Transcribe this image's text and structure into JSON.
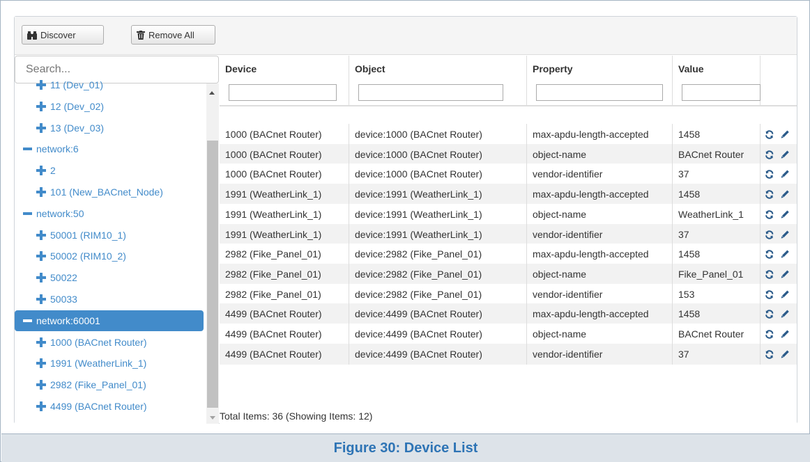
{
  "toolbar": {
    "discover_label": "Discover",
    "remove_all_label": "Remove All"
  },
  "sidebar": {
    "search_placeholder": "Search...",
    "tree": [
      {
        "label": "11 (Dev_01)",
        "kind": "device",
        "level": 1
      },
      {
        "label": "12 (Dev_02)",
        "kind": "device",
        "level": 1
      },
      {
        "label": "13 (Dev_03)",
        "kind": "device",
        "level": 1
      },
      {
        "label": "network:6",
        "kind": "network",
        "level": 0
      },
      {
        "label": "2",
        "kind": "device",
        "level": 1
      },
      {
        "label": "101 (New_BACnet_Node)",
        "kind": "device",
        "level": 1
      },
      {
        "label": "network:50",
        "kind": "network",
        "level": 0
      },
      {
        "label": "50001 (RIM10_1)",
        "kind": "device",
        "level": 1
      },
      {
        "label": "50002 (RIM10_2)",
        "kind": "device",
        "level": 1
      },
      {
        "label": "50022",
        "kind": "device",
        "level": 1
      },
      {
        "label": "50033",
        "kind": "device",
        "level": 1
      },
      {
        "label": "network:60001",
        "kind": "network",
        "level": 0,
        "selected": true
      },
      {
        "label": "1000 (BACnet Router)",
        "kind": "device",
        "level": 1
      },
      {
        "label": "1991 (WeatherLink_1)",
        "kind": "device",
        "level": 1
      },
      {
        "label": "2982 (Fike_Panel_01)",
        "kind": "device",
        "level": 1
      },
      {
        "label": "4499 (BACnet Router)",
        "kind": "device",
        "level": 1
      }
    ]
  },
  "grid": {
    "columns": [
      "Device",
      "Object",
      "Property",
      "Value"
    ],
    "rows": [
      [
        "1000 (BACnet Router)",
        "device:1000 (BACnet Router)",
        "max-apdu-length-accepted",
        "1458"
      ],
      [
        "1000 (BACnet Router)",
        "device:1000 (BACnet Router)",
        "object-name",
        "BACnet Router"
      ],
      [
        "1000 (BACnet Router)",
        "device:1000 (BACnet Router)",
        "vendor-identifier",
        "37"
      ],
      [
        "1991 (WeatherLink_1)",
        "device:1991 (WeatherLink_1)",
        "max-apdu-length-accepted",
        "1458"
      ],
      [
        "1991 (WeatherLink_1)",
        "device:1991 (WeatherLink_1)",
        "object-name",
        "WeatherLink_1"
      ],
      [
        "1991 (WeatherLink_1)",
        "device:1991 (WeatherLink_1)",
        "vendor-identifier",
        "37"
      ],
      [
        "2982 (Fike_Panel_01)",
        "device:2982 (Fike_Panel_01)",
        "max-apdu-length-accepted",
        "1458"
      ],
      [
        "2982 (Fike_Panel_01)",
        "device:2982 (Fike_Panel_01)",
        "object-name",
        "Fike_Panel_01"
      ],
      [
        "2982 (Fike_Panel_01)",
        "device:2982 (Fike_Panel_01)",
        "vendor-identifier",
        "153"
      ],
      [
        "4499 (BACnet Router)",
        "device:4499 (BACnet Router)",
        "max-apdu-length-accepted",
        "1458"
      ],
      [
        "4499 (BACnet Router)",
        "device:4499 (BACnet Router)",
        "object-name",
        "BACnet Router"
      ],
      [
        "4499 (BACnet Router)",
        "device:4499 (BACnet Router)",
        "vendor-identifier",
        "37"
      ]
    ],
    "footer": "Total Items: 36 (Showing Items: 12)"
  },
  "caption": "Figure 30: Device List",
  "colors": {
    "accent": "#428bca",
    "caption": "#2e74b5",
    "caption_bg": "#dde3e9"
  },
  "icons": {
    "discover": "binoculars-icon",
    "remove_all": "trash-icon",
    "expand": "plus-icon",
    "collapse": "minus-icon",
    "refresh": "refresh-icon",
    "edit": "pencil-icon"
  }
}
